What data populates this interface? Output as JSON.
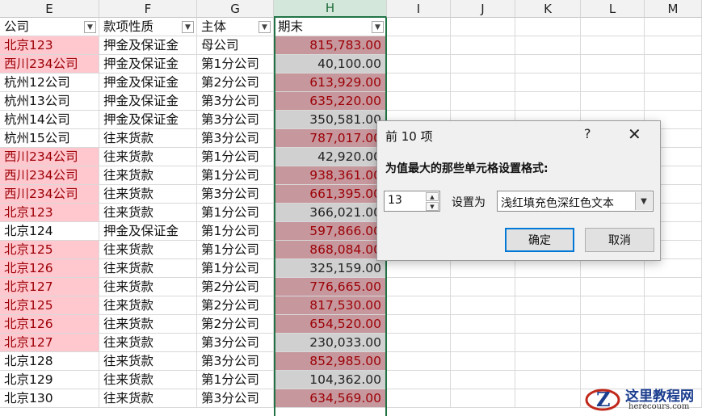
{
  "columns": [
    "E",
    "F",
    "G",
    "H",
    "I",
    "J",
    "K",
    "L",
    "M"
  ],
  "headers": {
    "E": "公司",
    "F": "款项性质",
    "G": "主体",
    "H": "期末"
  },
  "rows": [
    {
      "company": "北京123",
      "type": "押金及保证金",
      "entity": "母公司",
      "value": "815,783.00",
      "cstyle": "pink",
      "vstyle": "hl"
    },
    {
      "company": "西川234公司",
      "type": "押金及保证金",
      "entity": "第1分公司",
      "value": "40,100.00",
      "cstyle": "pink",
      "vstyle": "gry"
    },
    {
      "company": "杭州12公司",
      "type": "押金及保证金",
      "entity": "第2分公司",
      "value": "613,929.00",
      "cstyle": "",
      "vstyle": "hl"
    },
    {
      "company": "杭州13公司",
      "type": "押金及保证金",
      "entity": "第3分公司",
      "value": "635,220.00",
      "cstyle": "",
      "vstyle": "hl"
    },
    {
      "company": "杭州14公司",
      "type": "押金及保证金",
      "entity": "第3分公司",
      "value": "350,581.00",
      "cstyle": "",
      "vstyle": "gry"
    },
    {
      "company": "杭州15公司",
      "type": "往来货款",
      "entity": "第3分公司",
      "value": "787,017.00",
      "cstyle": "",
      "vstyle": "hl"
    },
    {
      "company": "西川234公司",
      "type": "往来货款",
      "entity": "第1分公司",
      "value": "42,920.00",
      "cstyle": "pink",
      "vstyle": "gry"
    },
    {
      "company": "西川234公司",
      "type": "往来货款",
      "entity": "第1分公司",
      "value": "938,361.00",
      "cstyle": "pink",
      "vstyle": "hl"
    },
    {
      "company": "西川234公司",
      "type": "往来货款",
      "entity": "第3分公司",
      "value": "661,395.00",
      "cstyle": "pink",
      "vstyle": "hl"
    },
    {
      "company": "北京123",
      "type": "往来货款",
      "entity": "第1分公司",
      "value": "366,021.00",
      "cstyle": "pink",
      "vstyle": "gry"
    },
    {
      "company": "北京124",
      "type": "押金及保证金",
      "entity": "第1分公司",
      "value": "597,866.00",
      "cstyle": "",
      "vstyle": "hl"
    },
    {
      "company": "北京125",
      "type": "往来货款",
      "entity": "第1分公司",
      "value": "868,084.00",
      "cstyle": "pink",
      "vstyle": "hl"
    },
    {
      "company": "北京126",
      "type": "往来货款",
      "entity": "第1分公司",
      "value": "325,159.00",
      "cstyle": "pink",
      "vstyle": "gry"
    },
    {
      "company": "北京127",
      "type": "往来货款",
      "entity": "第2分公司",
      "value": "776,665.00",
      "cstyle": "pink",
      "vstyle": "hl"
    },
    {
      "company": "北京125",
      "type": "往来货款",
      "entity": "第2分公司",
      "value": "817,530.00",
      "cstyle": "pink",
      "vstyle": "hl"
    },
    {
      "company": "北京126",
      "type": "往来货款",
      "entity": "第2分公司",
      "value": "654,520.00",
      "cstyle": "pink",
      "vstyle": "hl"
    },
    {
      "company": "北京127",
      "type": "往来货款",
      "entity": "第3分公司",
      "value": "230,033.00",
      "cstyle": "pink",
      "vstyle": "gry"
    },
    {
      "company": "北京128",
      "type": "往来货款",
      "entity": "第3分公司",
      "value": "852,985.00",
      "cstyle": "",
      "vstyle": "hl"
    },
    {
      "company": "北京129",
      "type": "往来货款",
      "entity": "第1分公司",
      "value": "104,362.00",
      "cstyle": "",
      "vstyle": "gry"
    },
    {
      "company": "北京130",
      "type": "往来货款",
      "entity": "第3分公司",
      "value": "634,569.00",
      "cstyle": "",
      "vstyle": "hl"
    }
  ],
  "dialog": {
    "title": "前 10 项",
    "help": "?",
    "close": "✕",
    "description": "为值最大的那些单元格设置格式:",
    "count": "13",
    "set_label": "设置为",
    "format_option": "浅红填充色深红色文本",
    "ok": "确定",
    "cancel": "取消"
  },
  "watermark": {
    "name": "这里教程网",
    "url": "herecours.com"
  }
}
